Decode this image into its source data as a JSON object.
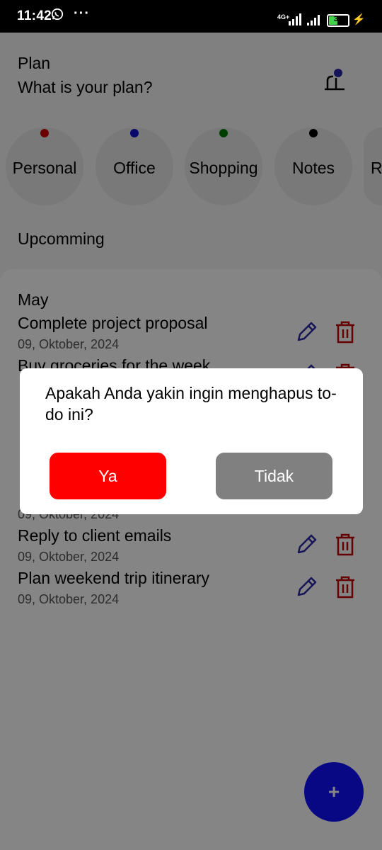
{
  "status_bar": {
    "time": "11:42",
    "more": "···",
    "network": "4G+",
    "battery": "38"
  },
  "header": {
    "title": "Plan",
    "subtitle": "What is your plan?",
    "profile_icon": "user-icon"
  },
  "categories": [
    {
      "label": "Personal",
      "color": "#cc0000"
    },
    {
      "label": "Office",
      "color": "#1010cc"
    },
    {
      "label": "Shopping",
      "color": "#007700"
    },
    {
      "label": "Notes",
      "color": "#000000"
    },
    {
      "label": "R",
      "color": "#888888"
    }
  ],
  "section": {
    "title": "Upcomming",
    "month": "May"
  },
  "todos": [
    {
      "title": "Complete project proposal",
      "date": "09, Oktober, 2024"
    },
    {
      "title": "Buy groceries for the week",
      "date": "09, Oktober, 2024"
    },
    {
      "title": "Reply to client emails",
      "date": "09, Oktober, 2024"
    },
    {
      "title": "Plan weekend trip itinerary",
      "date": "09, Oktober, 2024"
    }
  ],
  "partial_date": "09, Oktober, 2024",
  "fab": {
    "label": "+"
  },
  "dialog": {
    "message": "Apakah Anda yakin ingin menghapus to-do ini?",
    "confirm_label": "Ya",
    "cancel_label": "Tidak",
    "confirm_color": "#ff0000",
    "cancel_color": "#808080"
  },
  "colors": {
    "accent": "#1010ff",
    "edit": "#2a2aa8",
    "delete": "#c00000"
  }
}
